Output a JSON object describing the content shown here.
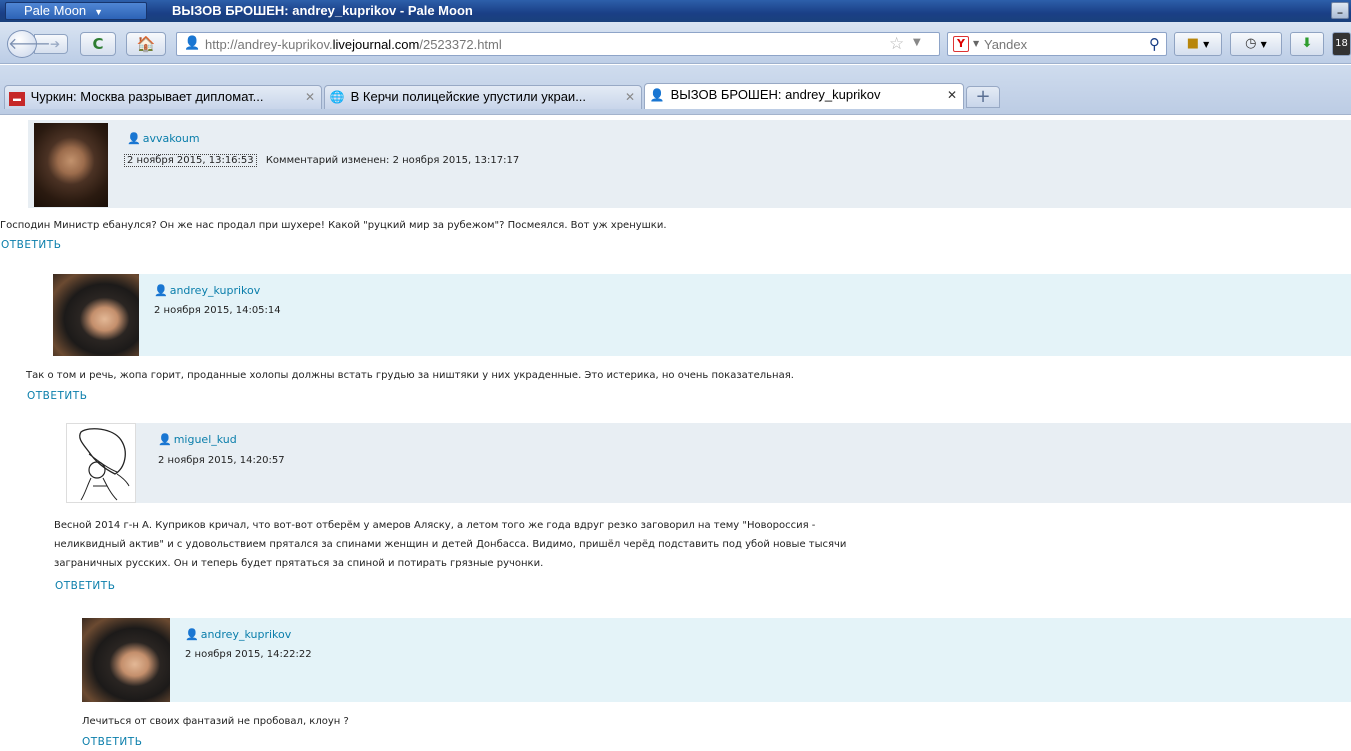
{
  "window": {
    "app_menu_label": "Pale Moon",
    "title": "ВЫЗОВ БРОШЕН: andrey_kuprikov - Pale Moon"
  },
  "navbar": {
    "url_prefix": "http://andrey-kuprikov.",
    "url_domain": "livejournal.com",
    "url_path": "/2523372.html",
    "search_placeholder": "Yandex",
    "clock_label": "18"
  },
  "tabs": [
    {
      "title": "Чуркин: Москва разрывает дипломат...",
      "favicon": "news-favicon",
      "active": false
    },
    {
      "title": "В Керчи полицейские упустили украи...",
      "favicon": "globe-favicon",
      "active": false
    },
    {
      "title": "ВЫЗОВ БРОШЕН: andrey_kuprikov",
      "favicon": "lj-favicon",
      "active": true
    }
  ],
  "comments": [
    {
      "user": "avvakoum",
      "date": "2 ноября 2015, 13:16:53",
      "edited": "Комментарий изменен:  2 ноября 2015, 13:17:17",
      "text_lines": [
        "Господин Министр ебанулся? Он же нас продал при шухере! Какой \"руцкий мир за рубежом\"? Посмеялся. Вот уж хренушки."
      ],
      "reply": "ОТВЕТИТЬ"
    },
    {
      "user": "andrey_kuprikov",
      "date": "2 ноября 2015, 14:05:14",
      "text_lines": [
        "Так о том и речь, жопа горит, проданные холопы должны встать грудью за ништяки у них украденные. Это истерика, но очень показательная."
      ],
      "reply": "ОТВЕТИТЬ"
    },
    {
      "user": "miguel_kud",
      "date": "2 ноября 2015, 14:20:57",
      "text_lines": [
        "Весной 2014 г-н А. Куприков кричал, что вот-вот отберём у амеров Аляску, а летом того же года вдруг резко заговорил на тему \"Новороссия -",
        "неликвидный актив\" и с удовольствием прятался за спинами женщин и детей Донбасса. Видимо, пришёл черёд подставить под убой новые тысячи",
        "заграничных русских. Он и теперь будет прятаться за спиной и потирать грязные ручонки."
      ],
      "reply": "ОТВЕТИТЬ"
    },
    {
      "user": "andrey_kuprikov",
      "date": "2 ноября 2015, 14:22:22",
      "text_lines": [
        "Лечиться от своих фантазий не пробовал, клоун ?"
      ],
      "reply": "ОТВЕТИТЬ"
    }
  ]
}
